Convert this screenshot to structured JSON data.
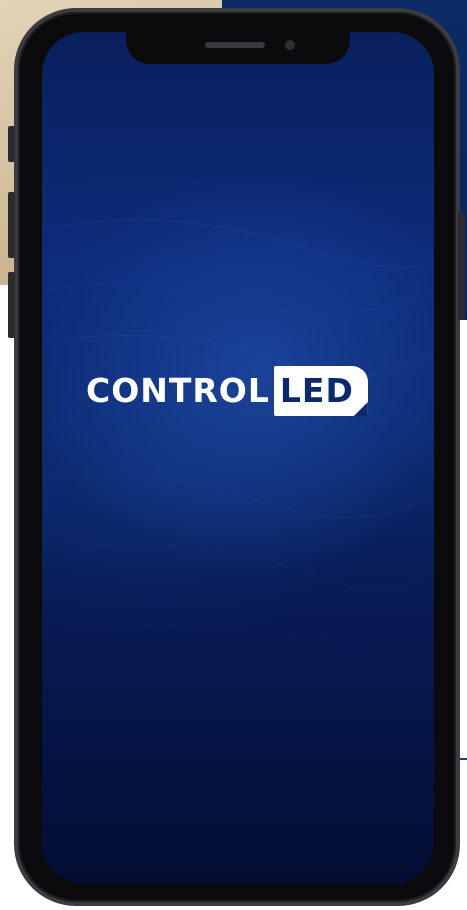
{
  "logo": {
    "text_main": "CONTROL",
    "text_highlight": "LED"
  },
  "colors": {
    "screen_top": "#0a1f5e",
    "screen_bottom": "#040e34",
    "logo_text": "#ffffff",
    "logo_highlight_bg": "#ffffff",
    "logo_highlight_text": "#0a2a6e"
  }
}
